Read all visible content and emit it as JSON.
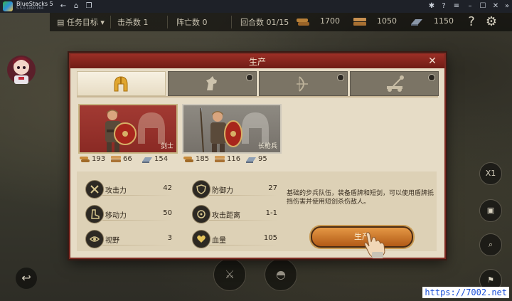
{
  "app": {
    "name": "BlueStacks 5",
    "version": "5.5.0.1000 P64"
  },
  "titlebar_buttons": [
    "help-icon",
    "menu-icon",
    "minimize-icon",
    "maximize-icon",
    "close-icon",
    "back-icon",
    "home-icon",
    "multi-window-icon"
  ],
  "hud": {
    "mission_label": "任务目标",
    "kills": "击杀数 1",
    "deaths": "阵亡数 0",
    "rounds": "回合数 01/15",
    "resources": [
      {
        "icon": "wood-icon",
        "value": "1700"
      },
      {
        "icon": "lumber-icon",
        "value": "1050"
      },
      {
        "icon": "iron-icon",
        "value": "1150"
      }
    ]
  },
  "side_buttons": [
    {
      "name": "speed-button",
      "label": "X1"
    },
    {
      "name": "bag-button",
      "label": ""
    },
    {
      "name": "zoom-button",
      "label": ""
    },
    {
      "name": "flag-button",
      "label": ""
    }
  ],
  "dialog": {
    "title": "生产",
    "tabs": [
      {
        "name": "infantry",
        "icon": "helmet-icon",
        "active": true,
        "locked": false
      },
      {
        "name": "cavalry",
        "icon": "horse-icon",
        "active": false,
        "locked": true
      },
      {
        "name": "archer",
        "icon": "bow-icon",
        "active": false,
        "locked": true
      },
      {
        "name": "siege",
        "icon": "catapult-icon",
        "active": false,
        "locked": true
      }
    ],
    "units": [
      {
        "name": "剑士",
        "selected": true,
        "costs": [
          "193",
          "66",
          "154"
        ]
      },
      {
        "name": "长枪兵",
        "selected": false,
        "costs": [
          "185",
          "116",
          "95"
        ]
      }
    ],
    "stats": [
      {
        "label": "攻击力",
        "value": "42",
        "icon": "swords-icon"
      },
      {
        "label": "防御力",
        "value": "27",
        "icon": "shield-icon"
      },
      {
        "label": "移动力",
        "value": "50",
        "icon": "boot-icon"
      },
      {
        "label": "攻击距离",
        "value": "1-1",
        "icon": "range-icon"
      },
      {
        "label": "视野",
        "value": "3",
        "icon": "eye-icon"
      },
      {
        "label": "血量",
        "value": "105",
        "icon": "heart-icon"
      }
    ],
    "description": "基础的步兵队伍，装备盾牌和短剑，可以使用盾牌抵挡伤害并使用短剑杀伤敌人。",
    "produce_button": "生产"
  },
  "watermark": "https://7002.net"
}
